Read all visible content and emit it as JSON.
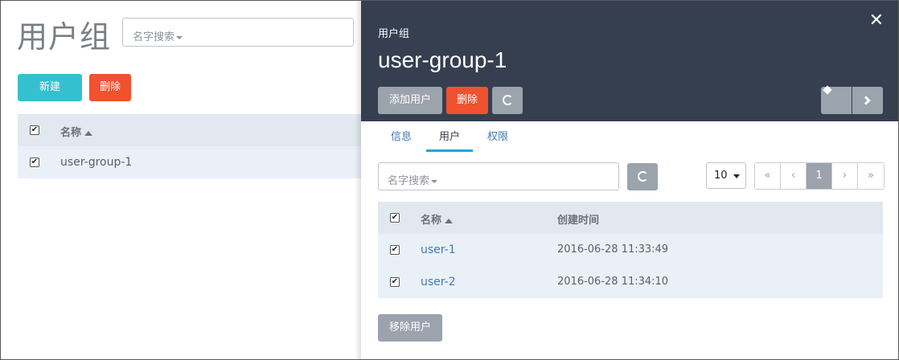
{
  "left": {
    "title": "用户组",
    "search_placeholder": "名字搜索",
    "new_label": "新建",
    "delete_label": "删除",
    "table": {
      "header_name": "名称",
      "rows": [
        {
          "name": "user-group-1",
          "checked": true
        }
      ]
    }
  },
  "panel": {
    "subtitle": "用户组",
    "title": "user-group-1",
    "close": "✕",
    "add_user_label": "添加用户",
    "delete_label": "删除",
    "tabs": [
      "信息",
      "用户",
      "权限"
    ],
    "active_tab": "用户",
    "search_placeholder": "名字搜索",
    "page_size": "10",
    "pager": {
      "first": "«",
      "prev": "‹",
      "current": "1",
      "next": "›",
      "last": "»"
    },
    "table": {
      "header_name": "名称",
      "header_created": "创建时间",
      "rows": [
        {
          "name": "user-1",
          "created": "2016-06-28 11:33:49",
          "checked": true
        },
        {
          "name": "user-2",
          "created": "2016-06-28 11:34:10",
          "checked": true
        }
      ]
    },
    "remove_user_label": "移除用户"
  },
  "colors": {
    "header_bg": "#353f50",
    "accent_teal": "#35c0cf",
    "danger": "#f0512f",
    "muted_btn": "#9ba3ad",
    "link": "#3f7ab6",
    "tab_underline": "#1fa2e0"
  }
}
